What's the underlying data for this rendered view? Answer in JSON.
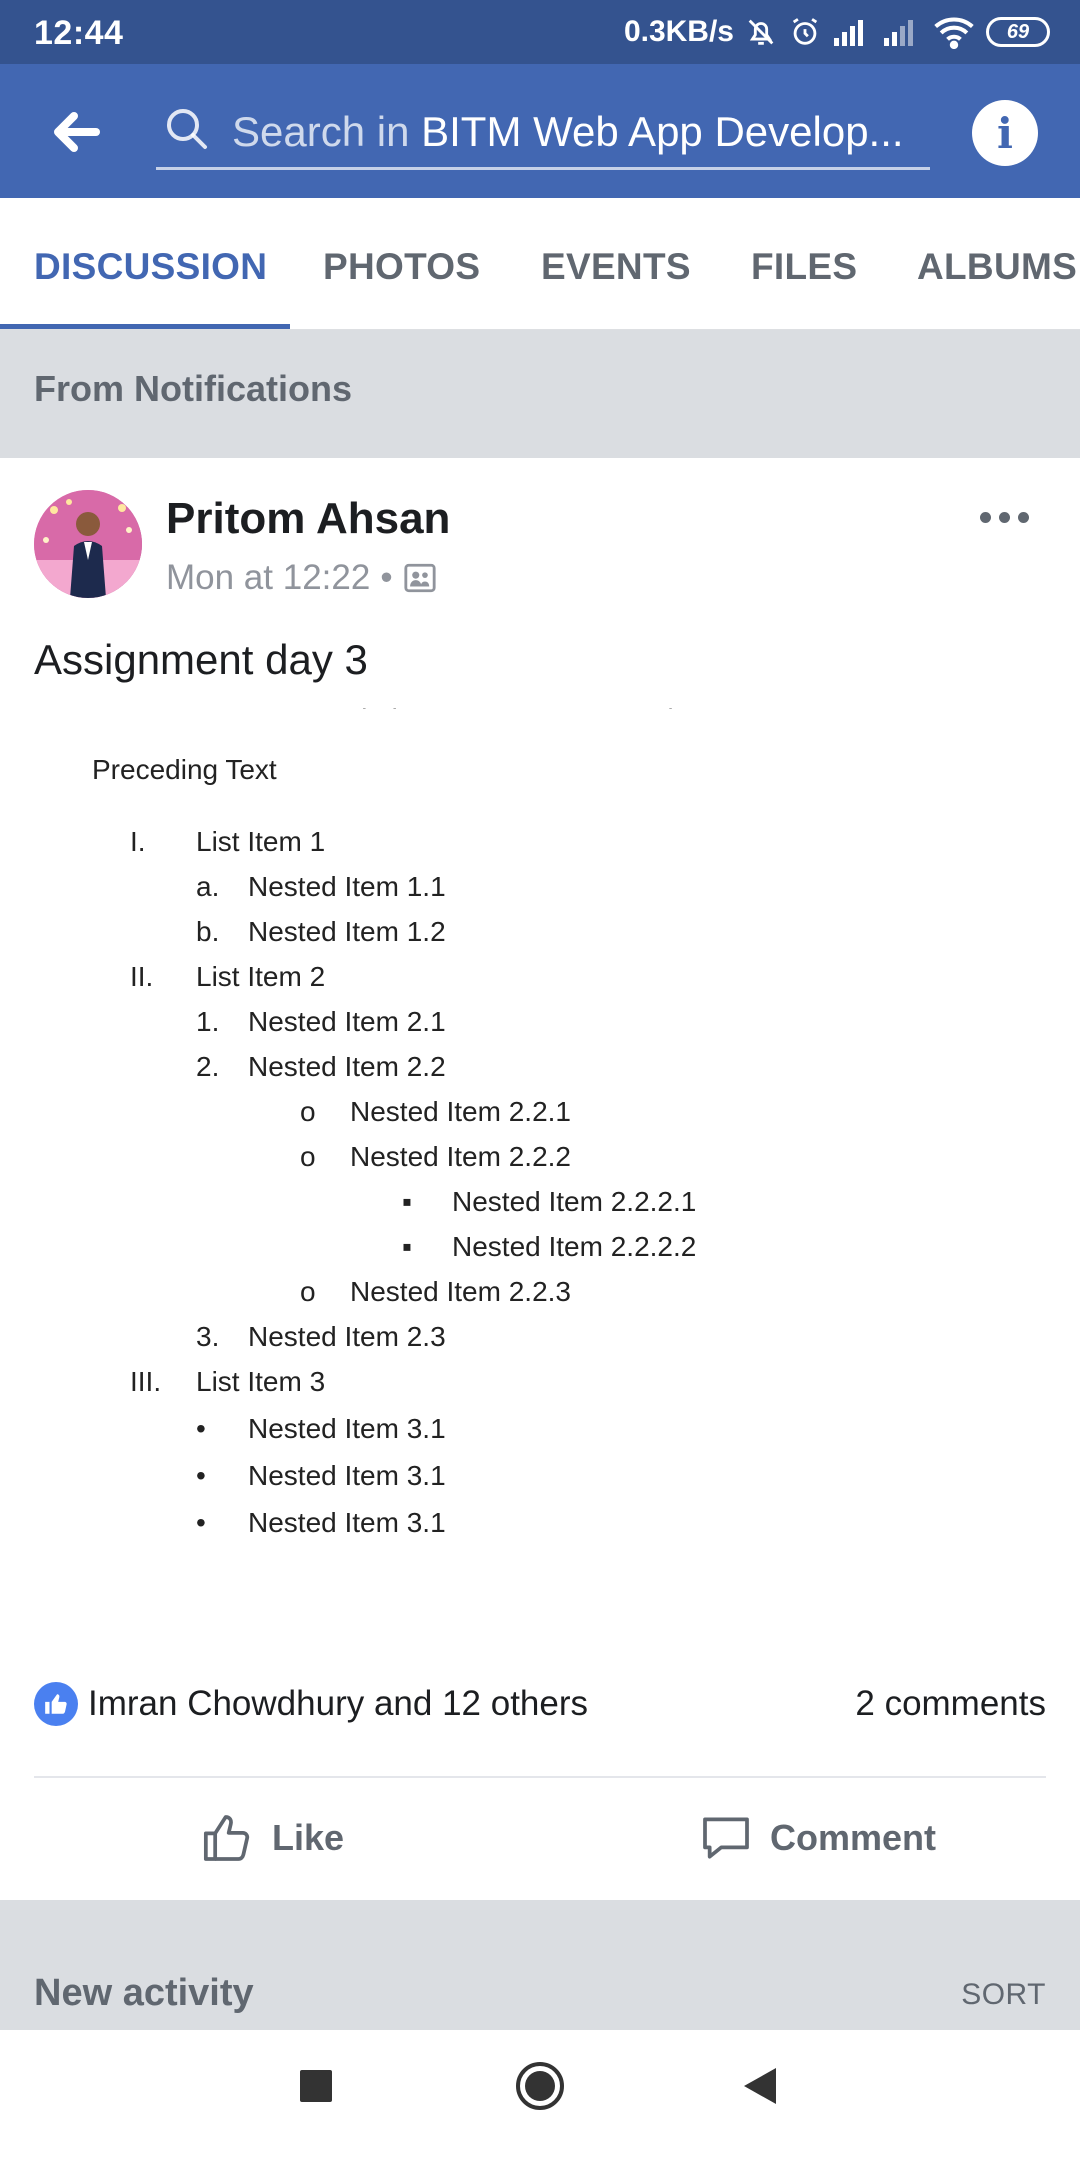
{
  "status_bar": {
    "time": "12:44",
    "network_speed": "0.3KB/s",
    "battery": "69",
    "icons": [
      "bell-off-icon",
      "alarm-icon",
      "signal-icon",
      "signal-icon",
      "wifi-icon",
      "battery-icon"
    ]
  },
  "app_bar": {
    "back_icon": "arrow-left-icon",
    "search_placeholder": "Search in ",
    "search_group": "BITM Web App Develop...",
    "info_icon": "info-icon",
    "info_label": "i"
  },
  "tabs": [
    {
      "label": "DISCUSSION",
      "active": true
    },
    {
      "label": "PHOTOS",
      "active": false
    },
    {
      "label": "EVENTS",
      "active": false
    },
    {
      "label": "FILES",
      "active": false
    },
    {
      "label": "ALBUMS",
      "active": false
    }
  ],
  "notification_banner": "From Notifications",
  "post": {
    "author": "Pritom Ahsan",
    "time": "Mon at 12:22",
    "separator": "•",
    "audience_icon": "group-icon",
    "text": "Assignment day 3",
    "document": {
      "preceding": "Preceding Text",
      "lines": [
        {
          "marker": "I.",
          "text": "List Item 1",
          "level": 1
        },
        {
          "marker": "a.",
          "text": "Nested Item 1.1",
          "level": 2
        },
        {
          "marker": "b.",
          "text": "Nested Item 1.2",
          "level": 2
        },
        {
          "marker": "II.",
          "text": "List Item 2",
          "level": 1
        },
        {
          "marker": "1.",
          "text": "Nested Item 2.1",
          "level": 2
        },
        {
          "marker": "2.",
          "text": "Nested Item 2.2",
          "level": 2
        },
        {
          "marker": "o",
          "text": "Nested Item 2.2.1",
          "level": 3
        },
        {
          "marker": "o",
          "text": "Nested Item 2.2.2",
          "level": 3
        },
        {
          "marker": "▪",
          "text": "Nested Item 2.2.2.1",
          "level": 4
        },
        {
          "marker": "▪",
          "text": "Nested Item 2.2.2.2",
          "level": 4
        },
        {
          "marker": "o",
          "text": "Nested Item 2.2.3",
          "level": 3
        },
        {
          "marker": "3.",
          "text": "Nested Item 2.3",
          "level": 2
        },
        {
          "marker": "III.",
          "text": "List Item 3",
          "level": 1
        },
        {
          "marker": "•",
          "text": "Nested Item 3.1",
          "level": 2
        },
        {
          "marker": "•",
          "text": "Nested Item 3.1",
          "level": 2
        },
        {
          "marker": "•",
          "text": "Nested Item 3.1",
          "level": 2
        }
      ]
    },
    "reactions": "Imran Chowdhury and 12 others",
    "comments": "2 comments",
    "like_label": "Like",
    "comment_label": "Comment"
  },
  "new_activity": {
    "title": "New activity",
    "sort_label": "SORT"
  },
  "nav_bar": {
    "icons": [
      "recent-apps-icon",
      "home-icon",
      "back-icon"
    ]
  },
  "colors": {
    "status_bar": "#34538f",
    "app_bar": "#4267b2",
    "accent": "#4267b2",
    "banner_bg": "#dadde1"
  }
}
